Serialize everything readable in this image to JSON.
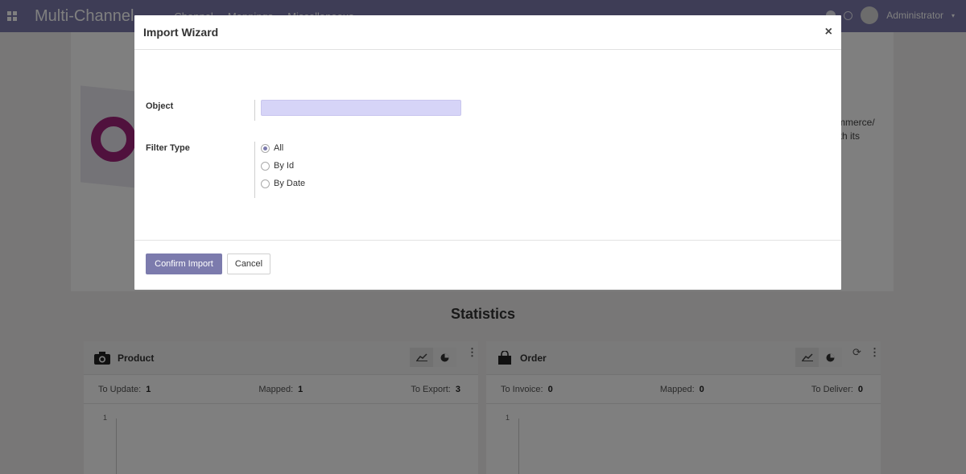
{
  "navbar": {
    "brand": "Multi-Channel",
    "menu": [
      "Channel",
      "Mappings",
      "Miscellaneous"
    ],
    "user": "Administrator"
  },
  "background": {
    "text_lines": [
      "mmerce/",
      "ith its"
    ],
    "statistics_title": "Statistics",
    "product_panel": {
      "title": "Product",
      "stats": [
        {
          "label": "To Update:",
          "value": "1"
        },
        {
          "label": "Mapped:",
          "value": "1"
        },
        {
          "label": "To Export:",
          "value": "3"
        }
      ],
      "y_tick": "1"
    },
    "order_panel": {
      "title": "Order",
      "stats": [
        {
          "label": "To Invoice:",
          "value": "0"
        },
        {
          "label": "Mapped:",
          "value": "0"
        },
        {
          "label": "To Deliver:",
          "value": "0"
        }
      ],
      "y_tick": "1"
    }
  },
  "modal": {
    "title": "Import Wizard",
    "close": "×",
    "object_label": "Object",
    "object_value": "",
    "filter_label": "Filter Type",
    "filter_options": [
      {
        "label": "All",
        "checked": true
      },
      {
        "label": "By Id",
        "checked": false
      },
      {
        "label": "By Date",
        "checked": false
      }
    ],
    "confirm_label": "Confirm Import",
    "cancel_label": "Cancel"
  },
  "colors": {
    "brand": "#7c7bad",
    "input_highlight": "#d6d4f7"
  }
}
